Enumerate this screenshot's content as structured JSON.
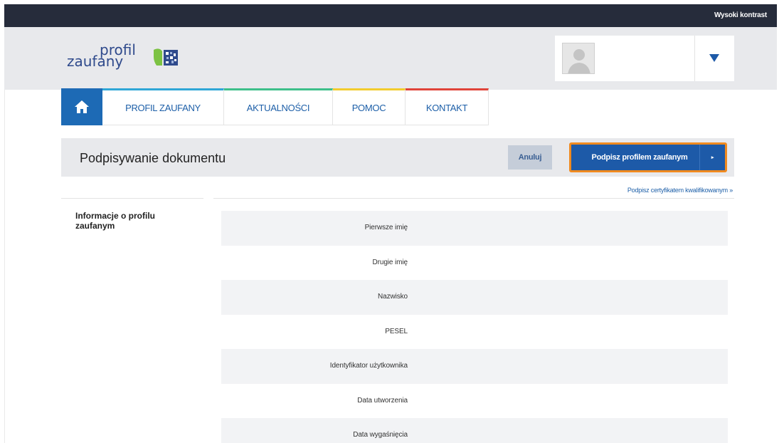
{
  "topbar": {
    "high_contrast": "Wysoki kontrast"
  },
  "logo": {
    "line1": "profil",
    "line2": "zaufany"
  },
  "nav": {
    "tabs": [
      {
        "label": "PROFIL ZAUFANY"
      },
      {
        "label": "AKTUALNOŚCI"
      },
      {
        "label": "POMOC"
      },
      {
        "label": "KONTAKT"
      }
    ]
  },
  "titlebar": {
    "title": "Podpisywanie dokumentu",
    "cancel_label": "Anuluj",
    "sign_label": "Podpisz profilem zaufanym",
    "sign_arrow": "▸"
  },
  "qualified_link": "Podpisz certyfikatem kwalifikowanym »",
  "side": {
    "heading": "Informacje o profilu zaufanym"
  },
  "rows": [
    {
      "label": "Pierwsze imię"
    },
    {
      "label": "Drugie imię"
    },
    {
      "label": "Nazwisko"
    },
    {
      "label": "PESEL"
    },
    {
      "label": "Identyfikator użytkownika"
    },
    {
      "label": "Data utworzenia"
    },
    {
      "label": "Data wygaśnięcia"
    }
  ],
  "colors": {
    "topbar": "#262c3b",
    "brand_blue": "#1d5aa8",
    "focus_orange": "#f08a1f",
    "tab_profil": "#2fa6d6",
    "tab_aktualnosci": "#3dbf8a",
    "tab_pomoc": "#f2cc2e",
    "tab_kontakt": "#e0443a"
  },
  "icons": {
    "home": "home-icon",
    "avatar": "user-avatar-icon",
    "dropdown": "caret-down-icon",
    "logo": "profil-zaufany-logo-icon"
  }
}
